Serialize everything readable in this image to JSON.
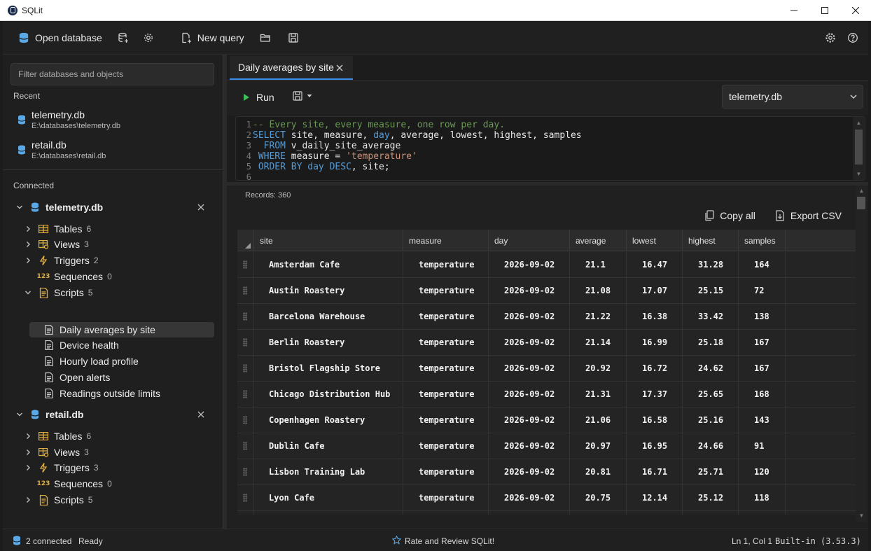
{
  "window": {
    "title": "SQLit"
  },
  "toolbar": {
    "open_database": "Open database",
    "new_query": "New query"
  },
  "sidebar": {
    "filter_placeholder": "Filter databases and objects",
    "recent_heading": "Recent",
    "recent": [
      {
        "name": "telemetry.db",
        "path": "E:\\databases\\telemetry.db"
      },
      {
        "name": "retail.db",
        "path": "E:\\databases\\retail.db"
      }
    ],
    "connected_heading": "Connected",
    "connections": [
      {
        "name": "telemetry.db",
        "groups": [
          {
            "label": "Tables",
            "count": "6"
          },
          {
            "label": "Views",
            "count": "3"
          },
          {
            "label": "Triggers",
            "count": "2"
          },
          {
            "label": "Sequences",
            "count": "0"
          },
          {
            "label": "Scripts",
            "count": "5"
          }
        ],
        "scripts": [
          "Daily averages by site",
          "Device health",
          "Hourly load profile",
          "Open alerts",
          "Readings outside limits"
        ],
        "selected_script": "Daily averages by site"
      },
      {
        "name": "retail.db",
        "groups": [
          {
            "label": "Tables",
            "count": "6"
          },
          {
            "label": "Views",
            "count": "3"
          },
          {
            "label": "Triggers",
            "count": "3"
          },
          {
            "label": "Sequences",
            "count": "0"
          },
          {
            "label": "Scripts",
            "count": "5"
          }
        ]
      }
    ]
  },
  "editor": {
    "tab_label": "Daily averages by site",
    "run_label": "Run",
    "database_select": "telemetry.db",
    "line_numbers": [
      "1",
      "2",
      "3",
      "4",
      "5",
      "6"
    ],
    "code": [
      "-- Every site, every measure, one row per day.",
      "SELECT site, measure, day, average, lowest, highest, samples",
      "  FROM v_daily_site_average",
      " WHERE measure = 'temperature'",
      " ORDER BY day DESC, site;"
    ]
  },
  "results": {
    "records_label": "Records: 360",
    "copy_all": "Copy all",
    "export_csv": "Export CSV",
    "columns": [
      "site",
      "measure",
      "day",
      "average",
      "lowest",
      "highest",
      "samples"
    ],
    "rows": [
      [
        "Amsterdam Cafe",
        "temperature",
        "2026-09-02",
        "21.1",
        "16.47",
        "31.28",
        "164"
      ],
      [
        "Austin Roastery",
        "temperature",
        "2026-09-02",
        "21.08",
        "17.07",
        "25.15",
        "72"
      ],
      [
        "Barcelona Warehouse",
        "temperature",
        "2026-09-02",
        "21.22",
        "16.38",
        "33.42",
        "138"
      ],
      [
        "Berlin Roastery",
        "temperature",
        "2026-09-02",
        "21.14",
        "16.99",
        "25.18",
        "167"
      ],
      [
        "Bristol Flagship Store",
        "temperature",
        "2026-09-02",
        "20.92",
        "16.72",
        "24.62",
        "167"
      ],
      [
        "Chicago Distribution Hub",
        "temperature",
        "2026-09-02",
        "21.31",
        "17.37",
        "25.65",
        "168"
      ],
      [
        "Copenhagen Roastery",
        "temperature",
        "2026-09-02",
        "21.06",
        "16.58",
        "25.16",
        "143"
      ],
      [
        "Dublin Cafe",
        "temperature",
        "2026-09-02",
        "20.97",
        "16.95",
        "24.66",
        "91"
      ],
      [
        "Lisbon Training Lab",
        "temperature",
        "2026-09-02",
        "20.81",
        "16.71",
        "25.71",
        "120"
      ],
      [
        "Lyon Cafe",
        "temperature",
        "2026-09-02",
        "20.75",
        "12.14",
        "25.12",
        "118"
      ]
    ]
  },
  "statusbar": {
    "connected": "2 connected",
    "state": "Ready",
    "rate": "Rate and Review SQLit!",
    "position": "Ln 1, Col 1",
    "engine": "Built-in (3.53.3)"
  },
  "colors": {
    "accent": "#3b8eea",
    "run": "#3fbf5a",
    "db_icon": "#5aa9e6",
    "table_icon": "#e0b040"
  }
}
